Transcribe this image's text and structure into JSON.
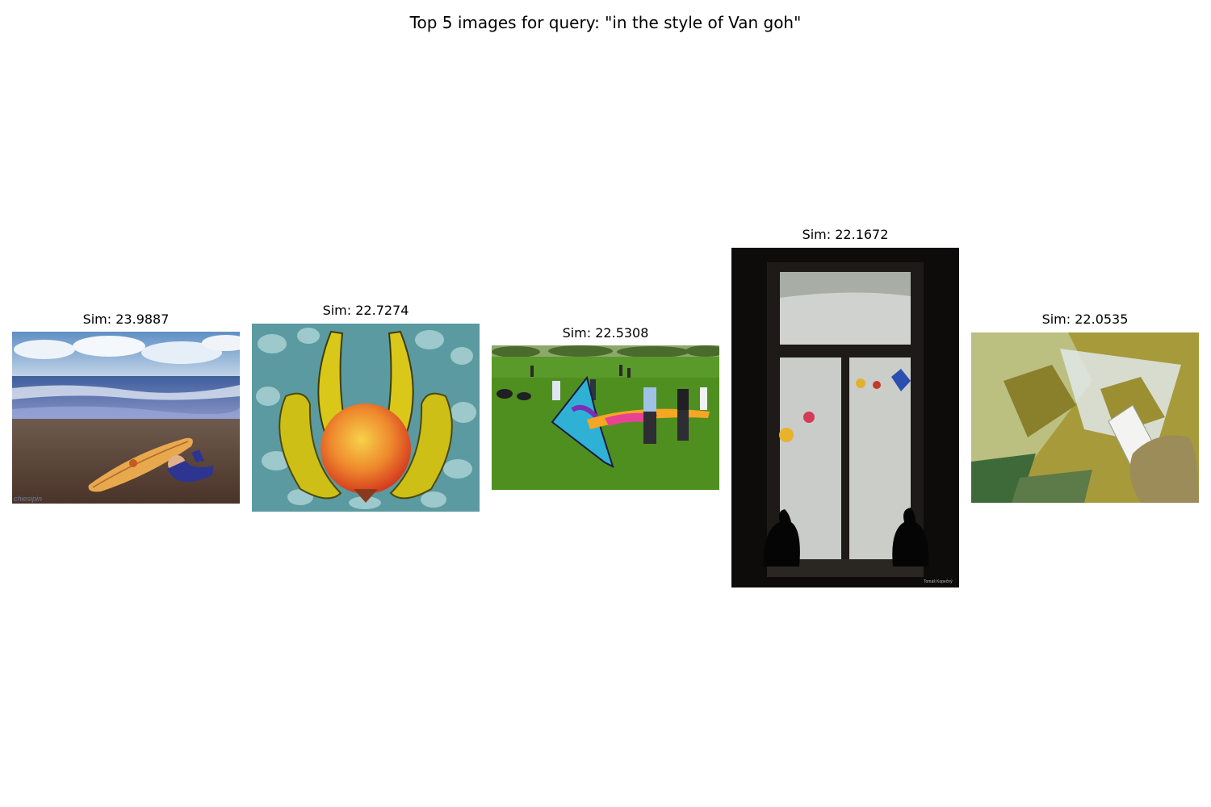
{
  "figure": {
    "title": "Top 5 images for query: \"in the style of Van goh\""
  },
  "results": [
    {
      "caption": "Sim: 23.9887",
      "thumbnail": "surfer-on-beach-photo",
      "watermark": "chiesipin"
    },
    {
      "caption": "Sim: 22.7274",
      "thumbnail": "bananas-and-pomegranate-photo"
    },
    {
      "caption": "Sim: 22.5308",
      "thumbnail": "kite-flying-in-park-photo"
    },
    {
      "caption": "Sim: 22.1672",
      "thumbnail": "cats-at-window-photo",
      "watermark": "Tomáš Kopečný"
    },
    {
      "caption": "Sim: 22.0535",
      "thumbnail": "hand-with-remote-projection-photo"
    }
  ]
}
